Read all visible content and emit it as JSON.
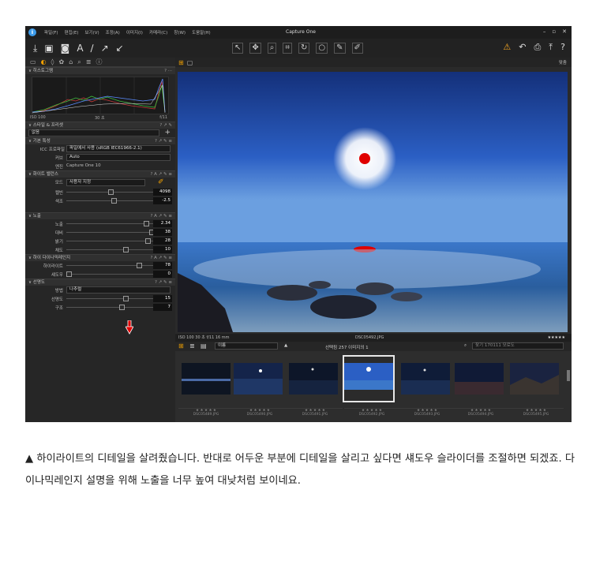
{
  "window": {
    "title": "Capture One",
    "menu": [
      "파일(F)",
      "편집(E)",
      "보기(V)",
      "조정(A)",
      "이미지(I)",
      "카메라(C)",
      "창(W)",
      "도움말(H)"
    ],
    "controls": [
      "–",
      "▫",
      "✕"
    ]
  },
  "left_panel": {
    "histogram": {
      "title": "히스토그램",
      "iso": "ISO 100",
      "shutter": "30 초",
      "aperture": "f/11"
    },
    "styles": {
      "title": "스타일 & 프리셋",
      "value": "없음"
    },
    "base": {
      "title": "기본 특성",
      "icc_label": "ICC 프로파일",
      "icc_value": "파일에서 사용 (sRGB IEC61966-2.1)",
      "curve_label": "커브",
      "curve_value": "Auto",
      "engine_label": "엔진",
      "engine_value": "Capture One 10"
    },
    "white_balance": {
      "title": "화이트 밸런스",
      "mode_label": "모드",
      "mode_value": "사용자 지정",
      "kelvin_label": "켈빈",
      "kelvin_value": "4098",
      "tint_label": "색조",
      "tint_value": "-2.5"
    },
    "exposure": {
      "title": "노출",
      "items": [
        {
          "label": "노출",
          "value": "2.34",
          "knob": 0.88
        },
        {
          "label": "대비",
          "value": "38",
          "knob": 0.95
        },
        {
          "label": "밝기",
          "value": "28",
          "knob": 0.9
        },
        {
          "label": "채도",
          "value": "10",
          "knob": 0.65
        }
      ]
    },
    "hdr": {
      "title": "하이 다이나믹레인지",
      "items": [
        {
          "label": "하이라이트",
          "value": "78",
          "knob": 0.8
        },
        {
          "label": "섀도우",
          "value": "0",
          "knob": 0.0
        }
      ]
    },
    "clarity": {
      "title": "선명도",
      "method_label": "방법",
      "method_value": "나추럴",
      "items": [
        {
          "label": "선명도",
          "value": "15",
          "knob": 0.65
        },
        {
          "label": "구조",
          "value": "7",
          "knob": 0.6
        }
      ]
    }
  },
  "viewer": {
    "header_right": "맞춤",
    "status_left": "ISO 100  30 초  f/11  16 mm",
    "status_center": "DSC05492.JPG",
    "rating": "★★★★★",
    "sort_label": "이름",
    "selection_info": "선택됨 257 이미지의 1",
    "search_placeholder": "찾기 170111 모로도"
  },
  "filmstrip": {
    "captions": [
      "DSC05489.JPG",
      "DSC05490.JPG",
      "DSC05491.JPG",
      "DSC05492.JPG",
      "DSC05493.JPG",
      "DSC05494.JPG",
      "DSC05495.JPG"
    ],
    "stars": "★ ★ ★ ★ ★"
  },
  "caption": "▲ 하이라이트의 디테일을 살려줬습니다. 반대로 어두운 부분에 디테일을 살리고 싶다면 섀도우 슬라이더를 조절하면 되겠죠. 다이나믹레인지 설명을 위해 노출을 너무 높여 대낮처럼 보이네요.",
  "colors": {
    "accent": "#f0a000",
    "arrow": "#e00000",
    "sky": "#2b5fc4"
  }
}
